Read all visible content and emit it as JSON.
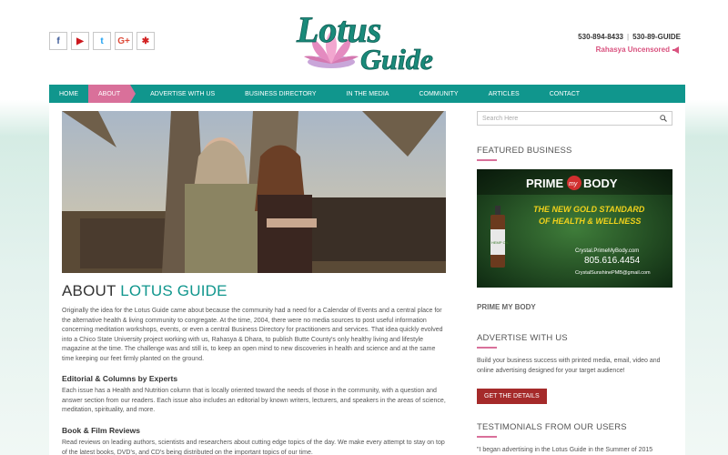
{
  "header": {
    "social": [
      {
        "name": "facebook-icon",
        "glyph": "f",
        "color": "#3b5998"
      },
      {
        "name": "youtube-icon",
        "glyph": "▶",
        "color": "#cc181e"
      },
      {
        "name": "twitter-icon",
        "glyph": "t",
        "color": "#1da1f2"
      },
      {
        "name": "google-plus-icon",
        "glyph": "G+",
        "color": "#dd4b39"
      },
      {
        "name": "yelp-icon",
        "glyph": "✱",
        "color": "#d32323"
      }
    ],
    "logo_line1": "Lotus",
    "logo_line2": "Guide",
    "phone1": "530-894-8433",
    "separator": "|",
    "phone2": "530-89-GUIDE",
    "uncensored": "Rahasya Uncensored"
  },
  "nav": {
    "items": [
      "HOME",
      "ABOUT",
      "ADVERTISE WITH US",
      "BUSINESS DIRECTORY",
      "IN THE MEDIA",
      "COMMUNITY",
      "ARTICLES",
      "CONTACT"
    ]
  },
  "main": {
    "title_plain": "ABOUT ",
    "title_accent": "LOTUS GUIDE",
    "intro": "Originally the idea for the Lotus Guide came about because the community had a need for a Calendar of Events and a central place for the alternative health & living community to congregate. At the time, 2004, there were no media sources to post useful information concerning meditation workshops, events, or even a central Business Directory for practitioners and services. That idea quickly evolved into a Chico State University project working with us, Rahasya & Dhara, to publish Butte County's only healthy living and lifestyle magazine at the time. The challenge was and still is, to keep an open mind to new discoveries in health and science and at the same time keeping our feet firmly planted on the ground.",
    "section1_title": "Editorial & Columns by Experts",
    "section1_text": "Each issue has a Health and Nutrition column that is locally oriented toward the needs of those in the community, with a question and answer section from our readers. Each issue also includes an editorial by known writers, lecturers, and speakers in the areas of science, meditation, spirituality, and more.",
    "section2_title": "Book & Film Reviews",
    "section2_text": "Read reviews on leading authors, scientists and researchers about cutting edge topics of the day. We make every attempt to stay on top of the latest books, DVD's, and CD's being distributed on the important topics of our time."
  },
  "sidebar": {
    "search_placeholder": "Search Here",
    "featured_title": "FEATURED BUSINESS",
    "ad": {
      "brand_left": "PRIME",
      "brand_mid": "my",
      "brand_right": "BODY",
      "tagline1": "THE NEW GOLD STANDARD",
      "tagline2": "OF HEALTH & WELLNESS",
      "url": "Crystal.PrimeMyBody.com",
      "phone": "805.616.4454",
      "email": "CrystalSunshinePMB@gmail.com",
      "bottle_label": "HEMP OIL"
    },
    "featured_name": "PRIME MY BODY",
    "advertise_title": "ADVERTISE WITH US",
    "advertise_text": "Build your business success with printed media, email, video and online advertising designed for your target audience!",
    "advertise_button": "GET THE DETAILS",
    "testimonials_title": "TESTIMONIALS FROM OUR USERS",
    "testimonial_text": "\"I began advertising in the Lotus Guide in the Summer of 2015"
  },
  "colors": {
    "teal": "#10968d",
    "pink": "#d9709a",
    "button": "#a52a2a",
    "uncensored": "#d9527f"
  }
}
